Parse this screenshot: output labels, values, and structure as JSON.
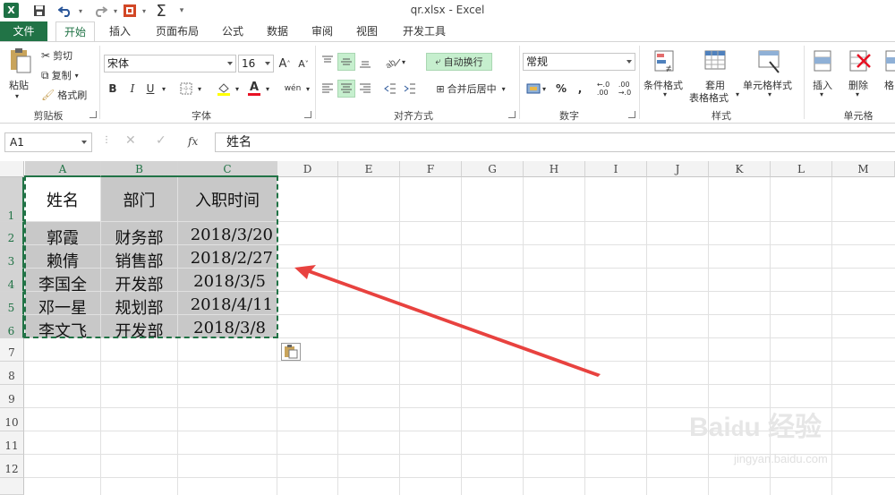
{
  "window": {
    "title": "qr.xlsx - Excel"
  },
  "tabs": [
    {
      "label": "文件"
    },
    {
      "label": "开始"
    },
    {
      "label": "插入"
    },
    {
      "label": "页面布局"
    },
    {
      "label": "公式"
    },
    {
      "label": "数据"
    },
    {
      "label": "审阅"
    },
    {
      "label": "视图"
    },
    {
      "label": "开发工具"
    }
  ],
  "ribbon": {
    "clipboard": {
      "paste": "粘贴",
      "cut": "剪切",
      "copy": "复制",
      "format_painter": "格式刷",
      "group": "剪贴板"
    },
    "font": {
      "name": "宋体",
      "size": "16",
      "grow": "A",
      "shrink": "A",
      "bold": "B",
      "italic": "I",
      "underline": "U",
      "wen": "wén",
      "group": "字体"
    },
    "alignment": {
      "wrap_text": "自动换行",
      "merge_center": "合并后居中",
      "group": "对齐方式"
    },
    "number": {
      "format": "常规",
      "percent": "%",
      "comma": ",",
      "group": "数字"
    },
    "styles": {
      "conditional": "条件格式",
      "table_line1": "套用",
      "table_line2": "表格格式",
      "cell_styles": "单元格样式",
      "group": "样式"
    },
    "cells": {
      "insert": "插入",
      "delete": "删除",
      "format": "格",
      "group": "单元格"
    }
  },
  "formula_bar": {
    "name_box": "A1",
    "fx": "fx",
    "content": "姓名"
  },
  "columns": [
    "A",
    "B",
    "C",
    "D",
    "E",
    "F",
    "G",
    "H",
    "I",
    "J",
    "K",
    "L",
    "M"
  ],
  "rows": [
    "1",
    "2",
    "3",
    "4",
    "5",
    "6",
    "7",
    "8",
    "9",
    "10",
    "11",
    "12"
  ],
  "table": {
    "header": [
      "姓名",
      "部门",
      "入职时间"
    ],
    "rows": [
      [
        "郭霞",
        "财务部",
        "2018/3/20"
      ],
      [
        "赖倩",
        "销售部",
        "2018/2/27"
      ],
      [
        "李国全",
        "开发部",
        "2018/3/5"
      ],
      [
        "邓一星",
        "规划部",
        "2018/4/11"
      ],
      [
        "李文飞",
        "开发部",
        "2018/3/8"
      ]
    ]
  },
  "colors": {
    "excel_green": "#217346",
    "selection_gray": "#c8c8c8",
    "arrow_red": "#e8423f"
  },
  "icons": [
    "excel-logo-icon",
    "save-icon",
    "undo-icon",
    "redo-icon",
    "sum-icon",
    "paste-options-icon"
  ]
}
